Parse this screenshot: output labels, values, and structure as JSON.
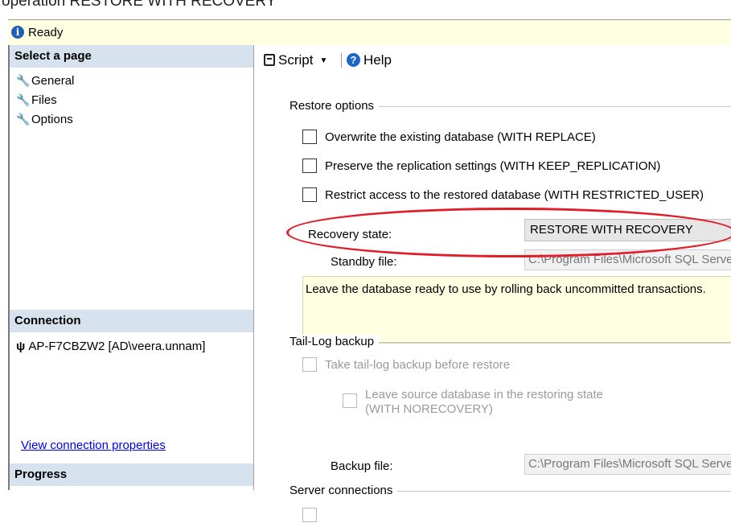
{
  "caption": "operation RESTORE WITH RECOVERY",
  "status": {
    "text": "Ready",
    "icon": "info-icon"
  },
  "sidebar": {
    "select_page_header": "Select a page",
    "pages": [
      {
        "label": "General",
        "icon": "wrench-icon"
      },
      {
        "label": "Files",
        "icon": "wrench-icon"
      },
      {
        "label": "Options",
        "icon": "wrench-icon"
      }
    ],
    "connection_header": "Connection",
    "connection_item": "AP-F7CBZW2 [AD\\veera.unnam]",
    "connection_link": "View connection properties",
    "progress_header": "Progress"
  },
  "toolbar": {
    "script_label": "Script",
    "help_label": "Help"
  },
  "restore_options": {
    "title": "Restore options",
    "checkboxes": [
      {
        "label": "Overwrite the existing database (WITH REPLACE)",
        "checked": false
      },
      {
        "label": "Preserve the replication settings (WITH KEEP_REPLICATION)",
        "checked": false
      },
      {
        "label": "Restrict access to the restored database (WITH RESTRICTED_USER)",
        "checked": false
      }
    ],
    "recovery_state_label": "Recovery state:",
    "recovery_state_value": "RESTORE WITH RECOVERY",
    "standby_file_label": "Standby file:",
    "standby_file_value": "C:\\Program Files\\Microsoft SQL Server",
    "description": "Leave the database ready to use by rolling back uncommitted transactions."
  },
  "tail_log": {
    "title": "Tail-Log backup",
    "take_backup_label": "Take tail-log backup before restore",
    "leave_source_label_line1": "Leave source database in the restoring state",
    "leave_source_label_line2": "(WITH NORECOVERY)",
    "backup_file_label": "Backup file:",
    "backup_file_value": "C:\\Program Files\\Microsoft SQL Server"
  },
  "server_connections": {
    "title": "Server connections"
  },
  "colors": {
    "highlight": "#e01e2a",
    "info_bar": "#ffffe1",
    "section_header": "#d6e2ee",
    "link": "#0000ee"
  }
}
